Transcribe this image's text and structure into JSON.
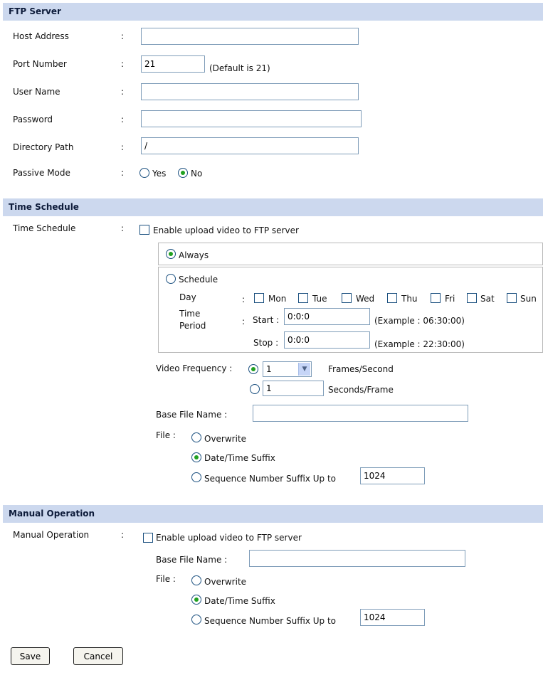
{
  "ftp_server": {
    "title": "FTP Server",
    "host_address_label": "Host Address",
    "host_address_value": "",
    "port_number_label": "Port Number",
    "port_number_value": "21",
    "port_default_note": "(Default is 21)",
    "user_name_label": "User Name",
    "user_name_value": "",
    "password_label": "Password",
    "password_value": "",
    "directory_path_label": "Directory Path",
    "directory_path_value": "/",
    "passive_mode_label": "Passive Mode",
    "passive_yes": "Yes",
    "passive_no": "No",
    "passive_selected": "No"
  },
  "colon": ":",
  "time_schedule": {
    "title": "Time Schedule",
    "row_label": "Time Schedule",
    "enable_label": "Enable upload video to FTP server",
    "enabled": false,
    "always_label": "Always",
    "schedule_label": "Schedule",
    "mode_selected": "Always",
    "day_label": "Day",
    "days": [
      "Mon",
      "Tue",
      "Wed",
      "Thu",
      "Fri",
      "Sat",
      "Sun"
    ],
    "time_period_label_1": "Time",
    "time_period_label_2": "Period",
    "start_label": "Start :",
    "start_value": "0:0:0",
    "start_example": "(Example : 06:30:00)",
    "stop_label": "Stop :",
    "stop_value": "0:0:0",
    "stop_example": "(Example : 22:30:00)",
    "video_frequency_label": "Video Frequency :",
    "fps_value": "1",
    "fps_unit": "Frames/Second",
    "spf_value": "1",
    "spf_unit": "Seconds/Frame",
    "frequency_selected": "Frames/Second",
    "base_file_name_label": "Base File Name :",
    "base_file_name_value": "",
    "file_label": "File :",
    "overwrite_label": "Overwrite",
    "date_time_label": "Date/Time Suffix",
    "sequence_label": "Sequence Number Suffix Up to",
    "sequence_value": "1024",
    "file_selected": "Date/Time Suffix"
  },
  "manual_operation": {
    "title": "Manual Operation",
    "row_label": "Manual Operation",
    "enable_label": "Enable upload video to FTP server",
    "enabled": false,
    "base_file_name_label": "Base File Name :",
    "base_file_name_value": "",
    "file_label": "File :",
    "overwrite_label": "Overwrite",
    "date_time_label": "Date/Time Suffix",
    "sequence_label": "Sequence Number Suffix Up to",
    "sequence_value": "1024",
    "file_selected": "Date/Time Suffix"
  },
  "buttons": {
    "save": "Save",
    "cancel": "Cancel"
  }
}
